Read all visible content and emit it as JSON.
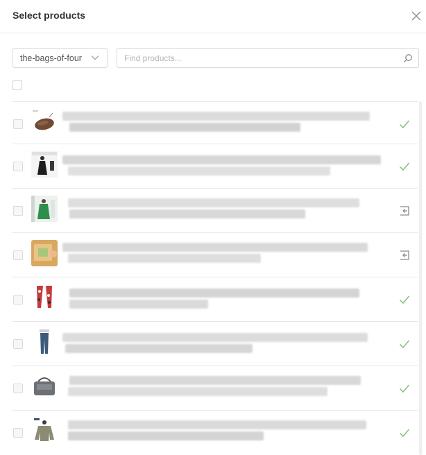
{
  "modal": {
    "title": "Select products"
  },
  "filter": {
    "collection_value": "the-bags-of-four"
  },
  "search": {
    "placeholder": "Find products..."
  },
  "colors": {
    "check": "#7dc473",
    "status_icon": "#8a8a8e",
    "border": "#e8e8ea"
  },
  "products": [
    {
      "status": "added",
      "thumb": "wallet-thumbnail"
    },
    {
      "status": "added",
      "thumb": "black-dress-thumbnail"
    },
    {
      "status": "available",
      "thumb": "green-coat-thumbnail"
    },
    {
      "status": "available",
      "thumb": "cardboard-box-thumbnail"
    },
    {
      "status": "added",
      "thumb": "patterned-leggings-thumbnail"
    },
    {
      "status": "added",
      "thumb": "jeans-thumbnail"
    },
    {
      "status": "added",
      "thumb": "messenger-bag-thumbnail"
    },
    {
      "status": "added",
      "thumb": "jacket-thumbnail"
    }
  ]
}
